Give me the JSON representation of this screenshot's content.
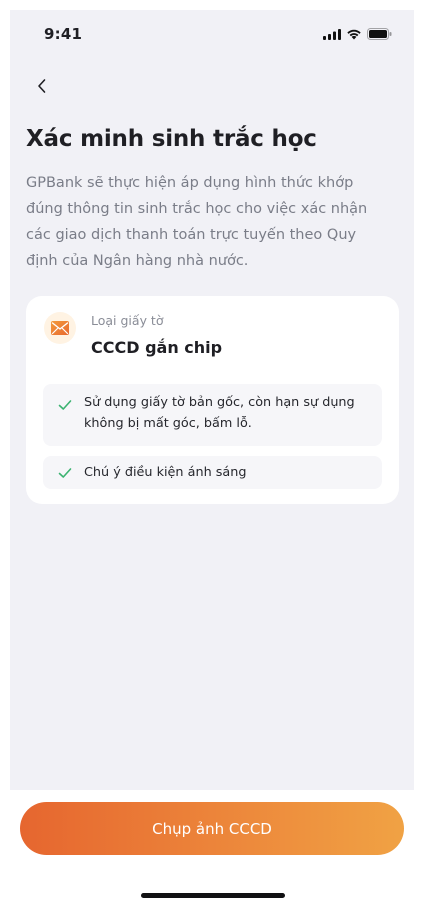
{
  "status_bar": {
    "time": "9:41",
    "icons": [
      "signal-icon",
      "wifi-icon",
      "battery-icon"
    ]
  },
  "nav": {
    "back_icon": "chevron-left-icon"
  },
  "header": {
    "title": "Xác minh sinh trắc học",
    "description": "GPBank sẽ thực hiện áp dụng hình thức khớp đúng thông tin sinh trắc học cho việc xác nhận các giao dịch thanh toán trực tuyến theo Quy định của Ngân hàng nhà nước."
  },
  "document": {
    "icon": "envelope-icon",
    "label": "Loại giấy tờ",
    "value": "CCCD gắn chip",
    "requirements": [
      {
        "icon": "check-icon",
        "text": "Sử dụng giấy tờ bản gốc, còn hạn sự dụng không bị mất góc, bấm lỗ."
      },
      {
        "icon": "check-icon",
        "text": "Chú ý điều kiện ánh sáng"
      }
    ]
  },
  "actions": {
    "primary_label": "Chụp ảnh CCCD"
  },
  "colors": {
    "accent_start": "#e6662f",
    "accent_end": "#f0a244",
    "check": "#3cb371",
    "background": "#f1f1f6"
  }
}
